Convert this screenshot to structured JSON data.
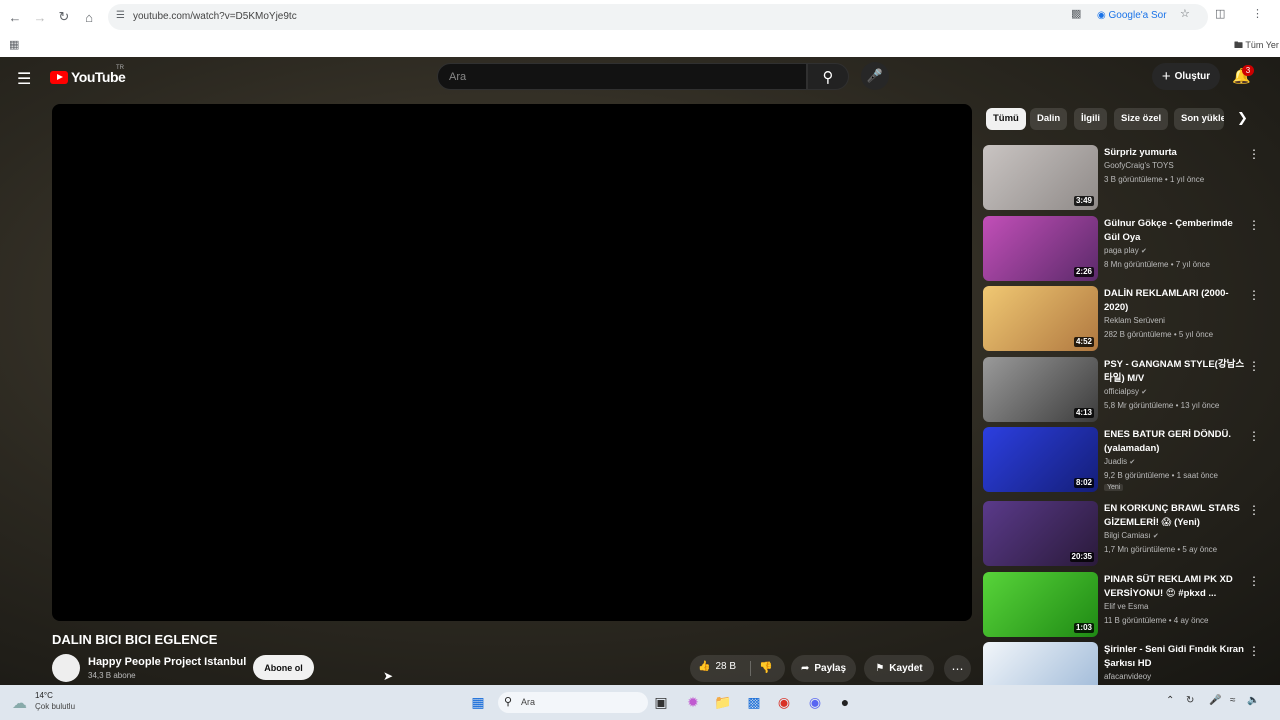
{
  "browser": {
    "url": "youtube.com/watch?v=D5KMoYje9tc",
    "ask_google": "Google'a Sor",
    "bookmarks_folder": "Tüm Yer"
  },
  "header": {
    "logo_text": "YouTube",
    "region": "TR",
    "search_placeholder": "Ara",
    "create_label": "Oluştur",
    "notification_count": "3"
  },
  "video": {
    "title": "DALIN BICI BICI EGLENCE",
    "channel": "Happy People Project Istanbul",
    "subscribers": "34,3 B abone",
    "subscribe_label": "Abone ol",
    "likes": "28 B",
    "share_label": "Paylaş",
    "save_label": "Kaydet"
  },
  "chips": [
    "Tümü",
    "Dalin",
    "İlgili",
    "Size özel",
    "Son yükle"
  ],
  "recommendations": [
    {
      "title": "Sürpriz yumurta",
      "channel": "GoofyCraig's TOYS",
      "meta": "3 B görüntüleme • 1 yıl önce",
      "duration": "3:49",
      "thumb_color": "#a8a2a0"
    },
    {
      "title": "Gülnur Gökçe - Çemberimde Gül Oya",
      "channel": "paga play",
      "meta": "8 Mn görüntüleme • 7 yıl önce",
      "duration": "2:26",
      "thumb_color": "#8f3f8f"
    },
    {
      "title": "DALİN REKLAMLARI (2000-2020)",
      "channel": "Reklam Serüveni",
      "meta": "282 B görüntüleme • 5 yıl önce",
      "duration": "4:52",
      "thumb_color": "#d9a55a"
    },
    {
      "title": "PSY - GANGNAM STYLE(강남스타일) M/V",
      "channel": "officialpsy",
      "meta": "5,8 Mr görüntüleme • 13 yıl önce",
      "duration": "4:13",
      "thumb_color": "#6a6a6a"
    },
    {
      "title": "ENES BATUR GERİ DÖNDÜ. (yalamadan)",
      "channel": "Juadis",
      "meta": "9,2 B görüntüleme • 1 saat önce",
      "badge": "Yeni",
      "duration": "8:02",
      "thumb_color": "#2838c0"
    },
    {
      "title": "EN KORKUNÇ BRAWL STARS GİZEMLERİ! 😱 (Yeni)",
      "channel": "Bilgi Camiası",
      "meta": "1,7 Mn görüntüleme • 5 ay önce",
      "duration": "20:35",
      "thumb_color": "#3a2a5a"
    },
    {
      "title": "PINAR SÜT REKLAMI PK XD VERSİYONU! 😍 #pkxd ...",
      "channel": "Elif ve Esma",
      "meta": "11 B görüntüleme • 4 ay önce",
      "duration": "1:03",
      "thumb_color": "#39b82a"
    },
    {
      "title": "Şirinler - Seni Gidi Fındık Kıran Şarkısı HD",
      "channel": "afacanvideoy",
      "meta": "",
      "duration": "",
      "thumb_color": "#d8e4ee"
    }
  ],
  "taskbar": {
    "temperature": "14°C",
    "weather": "Çok bulutlu",
    "search_placeholder": "Ara"
  }
}
